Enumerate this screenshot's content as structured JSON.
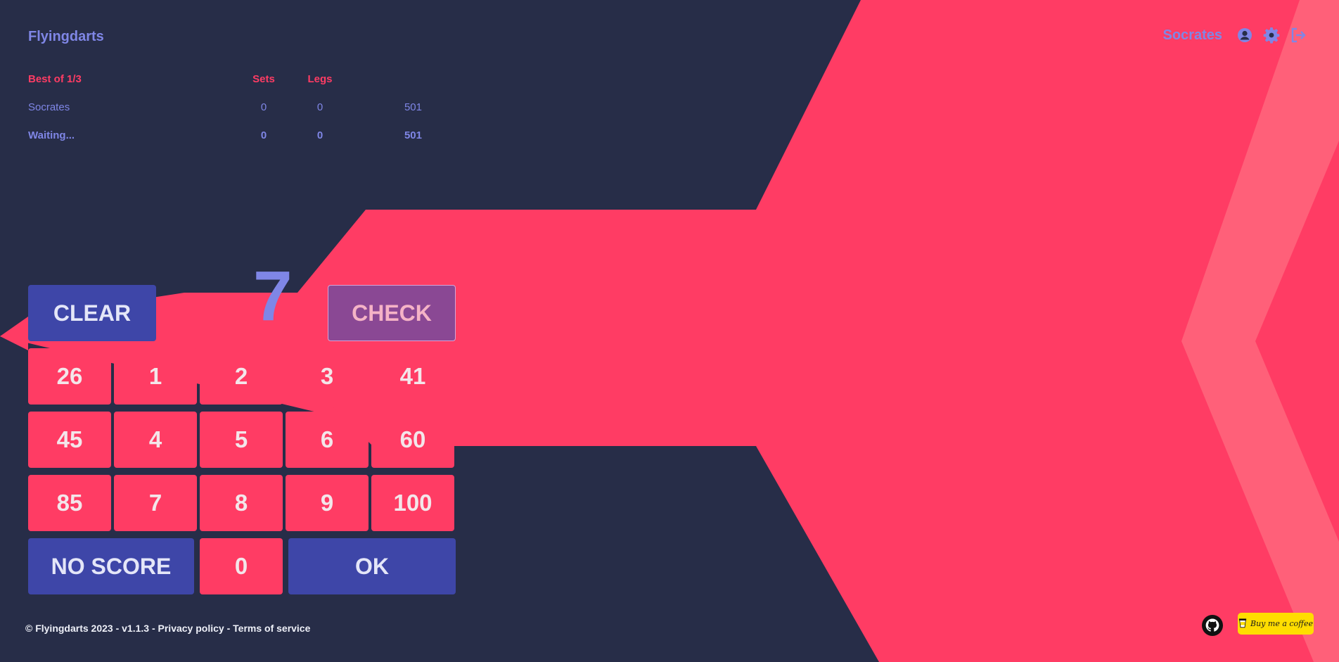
{
  "app": {
    "brand": "Flyingdarts"
  },
  "header": {
    "username": "Socrates",
    "icons": [
      "user-circle-icon",
      "gear-icon",
      "logout-icon"
    ]
  },
  "scoreboard": {
    "title": "Best of 1/3",
    "sets_label": "Sets",
    "legs_label": "Legs",
    "players": [
      {
        "name": "Socrates",
        "sets": "0",
        "legs": "0",
        "score": "501"
      },
      {
        "name": "Waiting...",
        "sets": "0",
        "legs": "0",
        "score": "501"
      }
    ]
  },
  "input": {
    "current_value": "7"
  },
  "keypad": {
    "clear": "CLEAR",
    "check": "CHECK",
    "keys": [
      "26",
      "1",
      "2",
      "3",
      "41",
      "45",
      "4",
      "5",
      "6",
      "60",
      "85",
      "7",
      "8",
      "9",
      "100"
    ],
    "no_score": "NO SCORE",
    "zero": "0",
    "ok": "OK"
  },
  "footer": {
    "copyright": "© Flyingdarts 2023 - v1.1.3 - ",
    "privacy": "Privacy policy",
    "separator": " - ",
    "terms": "Terms of service",
    "coffee_label": "Buy me a coffee"
  },
  "colors": {
    "background": "#272d48",
    "accent_red": "#ff3c64",
    "accent_blue": "#3e46a8",
    "text_blue": "#7f86e6",
    "check_purple": "#8a4894",
    "coffee_yellow": "#ffdd00"
  }
}
